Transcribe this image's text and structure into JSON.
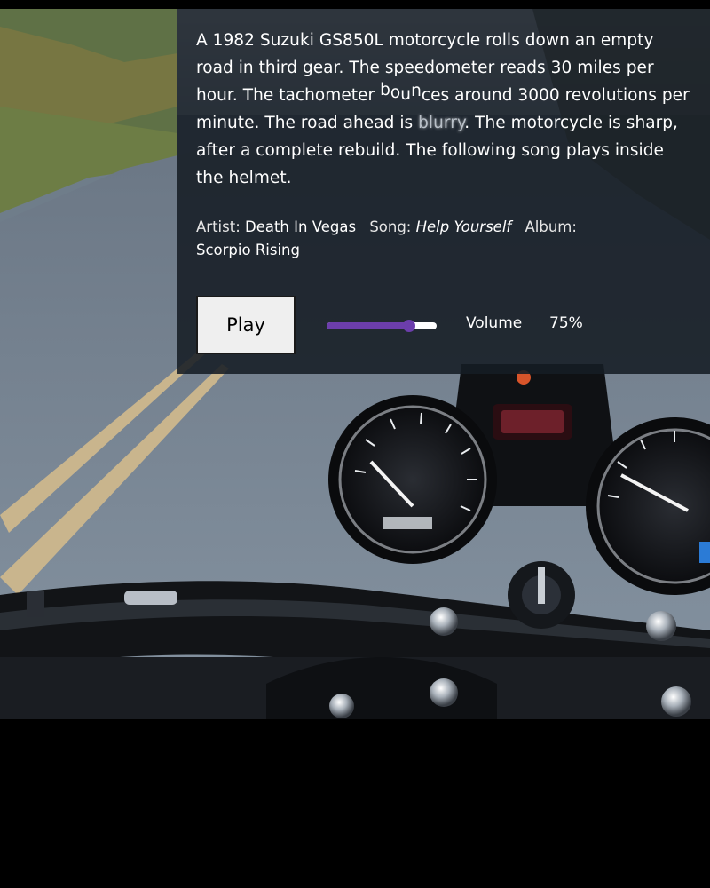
{
  "description": {
    "part1": "A 1982 Suzuki GS850L motorcycle rolls down an empty road in third gear. The speedometer reads 30 miles per hour. The tachometer ",
    "bounce_letters": [
      "b",
      "o",
      "u",
      "n",
      "c",
      "es"
    ],
    "part2": " around 3000 revolutions per minute. The road ahead is ",
    "blurry_word": "blurry",
    "part3": ". The motorcycle is sharp, after a complete rebuild. The following song plays inside the helmet."
  },
  "track": {
    "artist_label": "Artist:",
    "artist": "Death In Vegas",
    "song_label": "Song:",
    "song": "Help Yourself",
    "album_label": "Album:",
    "album": "Scorpio Rising"
  },
  "controls": {
    "play_label": "Play",
    "volume_label": "Volume",
    "volume_value": "75%",
    "volume_fraction": 0.75
  },
  "colors": {
    "slider_accent": "#6c3eac",
    "panel_bg": "#161c24"
  },
  "background": {
    "subject": "motorcycle handlebars and gauges on an empty road"
  }
}
